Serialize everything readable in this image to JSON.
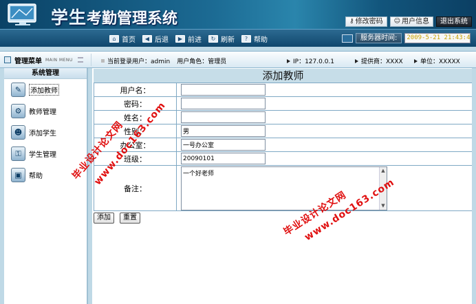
{
  "header": {
    "title_main": "学生",
    "title_sub": "考勤管理系统",
    "actions": [
      "修改密码",
      "用户信息",
      "退出系统"
    ]
  },
  "nav": {
    "links": [
      "首页",
      "后退",
      "前进",
      "刷新",
      "帮助"
    ],
    "server_label": "服务器时间:",
    "server_time": "2009-5-21 21:43:4"
  },
  "menu": {
    "title": "管理菜单",
    "subtitle": "MAIN MENU",
    "section": "系统管理",
    "items": [
      "添加教师",
      "教师管理",
      "添加学生",
      "学生管理",
      "帮助"
    ]
  },
  "info": {
    "login_user": "当前登录用户：admin",
    "role": "用户角色：管理员",
    "ip": "IP：127.0.0.1",
    "provider": "提供商：XXXX",
    "unit": "单位：XXXXX"
  },
  "form": {
    "title": "添加教师",
    "labels": {
      "username": "用户名：",
      "password": "密码：",
      "name": "姓名：",
      "gender": "性别：",
      "office": "办公室：",
      "class": "班级：",
      "remark": "备注："
    },
    "values": {
      "username": "",
      "password": "",
      "name": "",
      "gender": "男",
      "office": "一号办公室",
      "class": "20090101",
      "remark": "一个好老师"
    },
    "buttons": {
      "add": "添加",
      "reset": "重置"
    }
  },
  "watermark": {
    "cn": "毕业设计论文网",
    "url": "www.doc163.com"
  },
  "colors": {
    "banner": "#1c6b94",
    "nav": "#10476d",
    "page_bg": "#bfd9e6",
    "watermark": "#e01010",
    "time_text": "#c8a200"
  }
}
